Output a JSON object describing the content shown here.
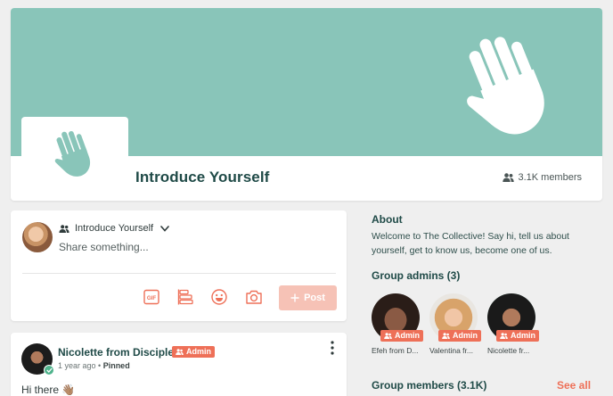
{
  "group": {
    "title": "Introduce Yourself",
    "member_count": "3.1K members"
  },
  "composer": {
    "target_group": "Introduce Yourself",
    "placeholder": "Share something...",
    "tools": [
      "gif-icon",
      "poll-icon",
      "emoji-icon",
      "camera-icon"
    ],
    "post_label": "Post"
  },
  "post": {
    "author": "Nicolette from Disciple",
    "badge": "Admin",
    "time": "1 year ago",
    "pinned": "Pinned",
    "body": "Hi there 👋🏽"
  },
  "about": {
    "title": "About",
    "text": "Welcome to The Collective! Say hi, tell us about yourself, get to know us, become one of us."
  },
  "admins": {
    "title": "Group admins (3)",
    "badge": "Admin",
    "items": [
      {
        "name": "Efeh from D..."
      },
      {
        "name": "Valentina fr..."
      },
      {
        "name": "Nicolette fr..."
      }
    ]
  },
  "members": {
    "title": "Group members (3.1K)",
    "see_all": "See all"
  },
  "colors": {
    "cover": "#89c5b9",
    "accent": "#ee7058",
    "heading": "#1f4a47",
    "post_button": "#f6c2b6"
  }
}
